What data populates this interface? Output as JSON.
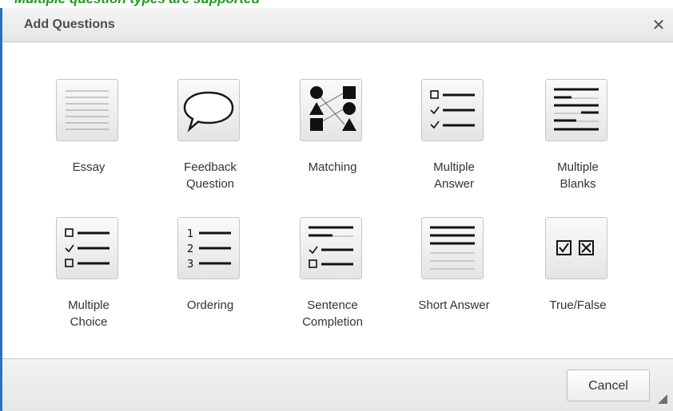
{
  "page": {
    "header_fragment": "Multiple question types are supported"
  },
  "dialog": {
    "title": "Add Questions",
    "close_glyph": "✕",
    "cancel_label": "Cancel"
  },
  "question_types": [
    {
      "label_line1": "Essay",
      "label_line2": "",
      "icon": "essay-icon"
    },
    {
      "label_line1": "Feedback",
      "label_line2": "Question",
      "icon": "speech-bubble-icon"
    },
    {
      "label_line1": "Matching",
      "label_line2": "",
      "icon": "matching-shapes-icon"
    },
    {
      "label_line1": "Multiple",
      "label_line2": "Answer",
      "icon": "checklist-icon"
    },
    {
      "label_line1": "Multiple",
      "label_line2": "Blanks",
      "icon": "blank-lines-icon"
    },
    {
      "label_line1": "Multiple",
      "label_line2": "Choice",
      "icon": "choice-list-icon"
    },
    {
      "label_line1": "Ordering",
      "label_line2": "",
      "icon": "numbered-list-icon"
    },
    {
      "label_line1": "Sentence",
      "label_line2": "Completion",
      "icon": "sentence-completion-icon"
    },
    {
      "label_line1": "Short Answer",
      "label_line2": "",
      "icon": "short-answer-icon"
    },
    {
      "label_line1": "True/False",
      "label_line2": "",
      "icon": "true-false-icon"
    }
  ],
  "ordering_numbers": [
    "1",
    "2",
    "3"
  ],
  "colors": {
    "accent_border": "#2a73b8",
    "header_text_green": "#1a9e1a"
  }
}
